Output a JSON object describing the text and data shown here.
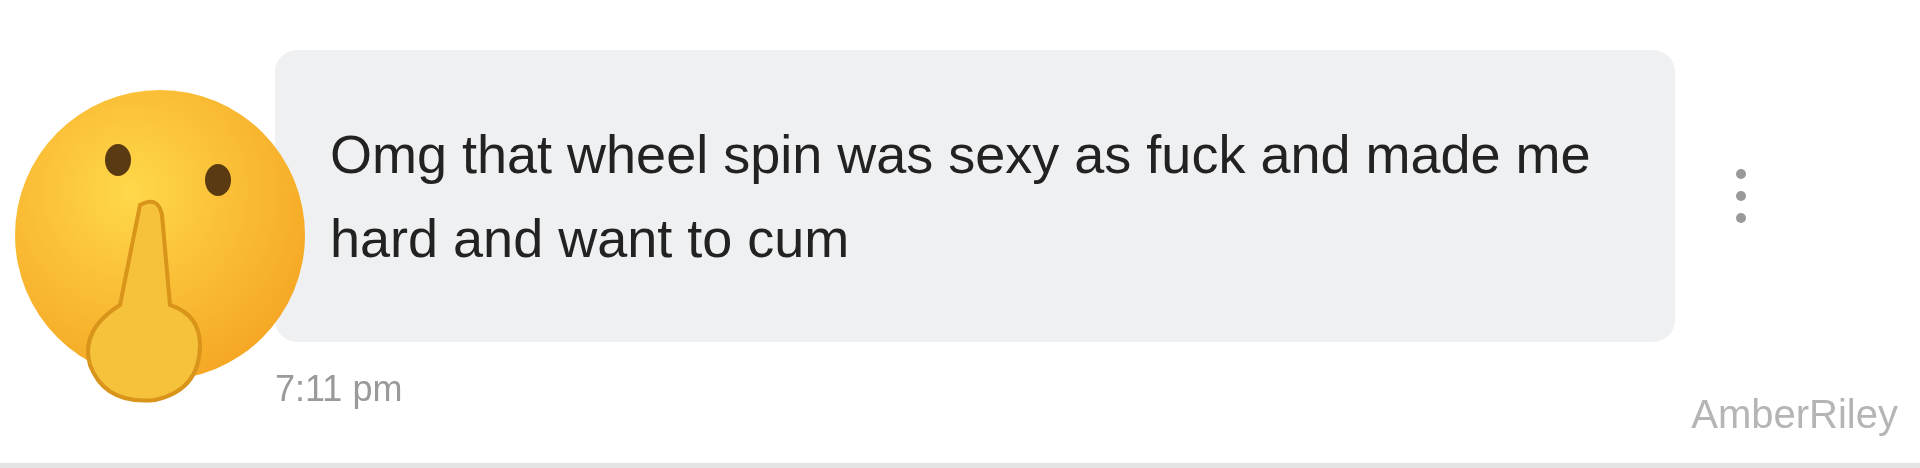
{
  "message": {
    "text": "Omg that wheel spin was sexy as fuck and made me hard and want to cum",
    "time": "7:11 pm"
  },
  "sender_name": "AmberRiley"
}
